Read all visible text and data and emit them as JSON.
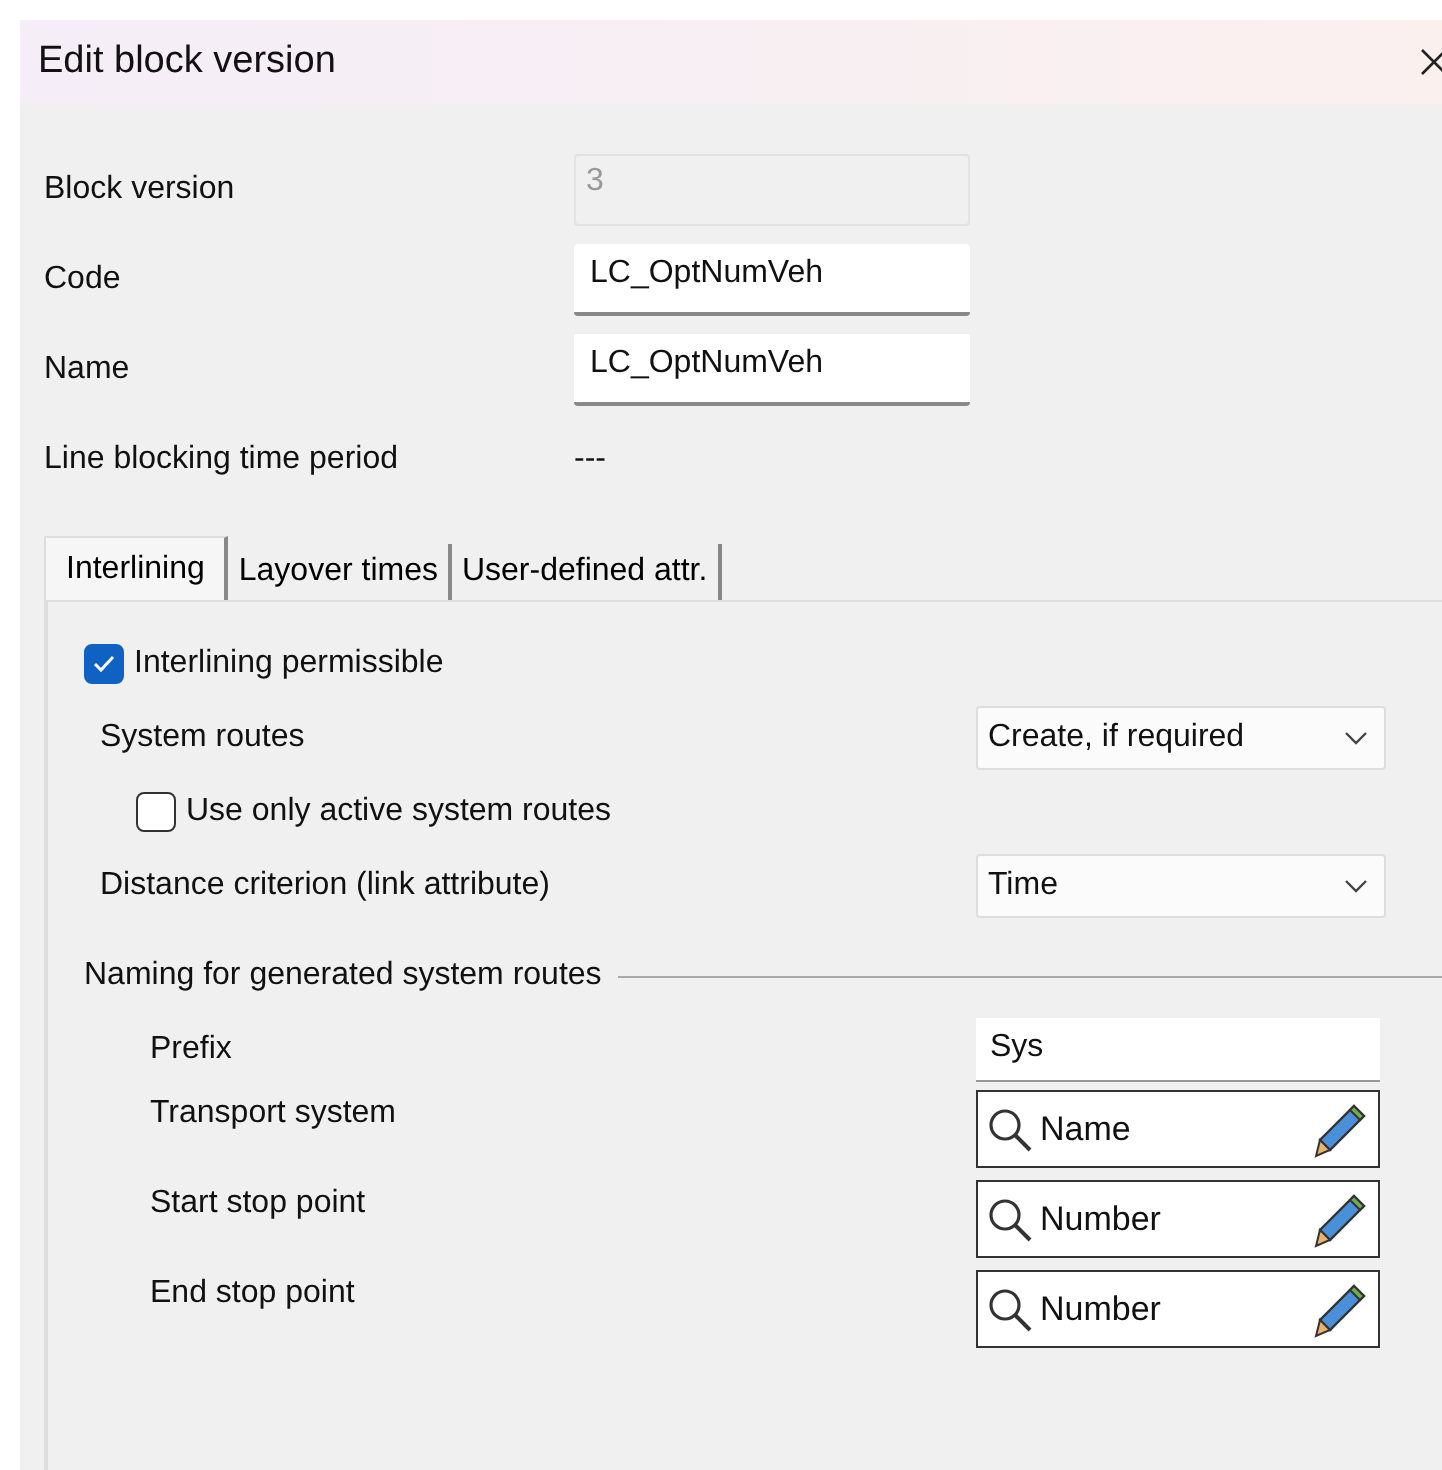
{
  "window": {
    "title": "Edit block version"
  },
  "fields": [
    {
      "label": "Block version",
      "value": "3",
      "kind": "readonly"
    },
    {
      "label": "Code",
      "value": "LC_OptNumVeh",
      "kind": "input"
    },
    {
      "label": "Name",
      "value": "LC_OptNumVeh",
      "kind": "input"
    },
    {
      "label": "Line blocking time period",
      "value": "---",
      "kind": "text"
    }
  ],
  "tabs": [
    {
      "label": "Interlining",
      "selected": true
    },
    {
      "label": "Layover times",
      "selected": false
    },
    {
      "label": "User-defined attr.",
      "selected": false
    }
  ],
  "interlining": {
    "permissible": {
      "label": "Interlining permissible",
      "checked": true
    },
    "system_routes": {
      "label": "System routes",
      "value": "Create, if required"
    },
    "active_only": {
      "label": "Use only active system routes",
      "checked": false
    },
    "distance": {
      "label": "Distance criterion (link attribute)",
      "value": "Time"
    }
  },
  "naming": {
    "title": "Naming for generated system routes",
    "prefix": {
      "label": "Prefix",
      "value": "Sys"
    },
    "attributes": [
      {
        "label": "Transport system",
        "value": "Name"
      },
      {
        "label": "Start stop point",
        "value": "Number"
      },
      {
        "label": "End stop point",
        "value": "Number"
      }
    ]
  }
}
